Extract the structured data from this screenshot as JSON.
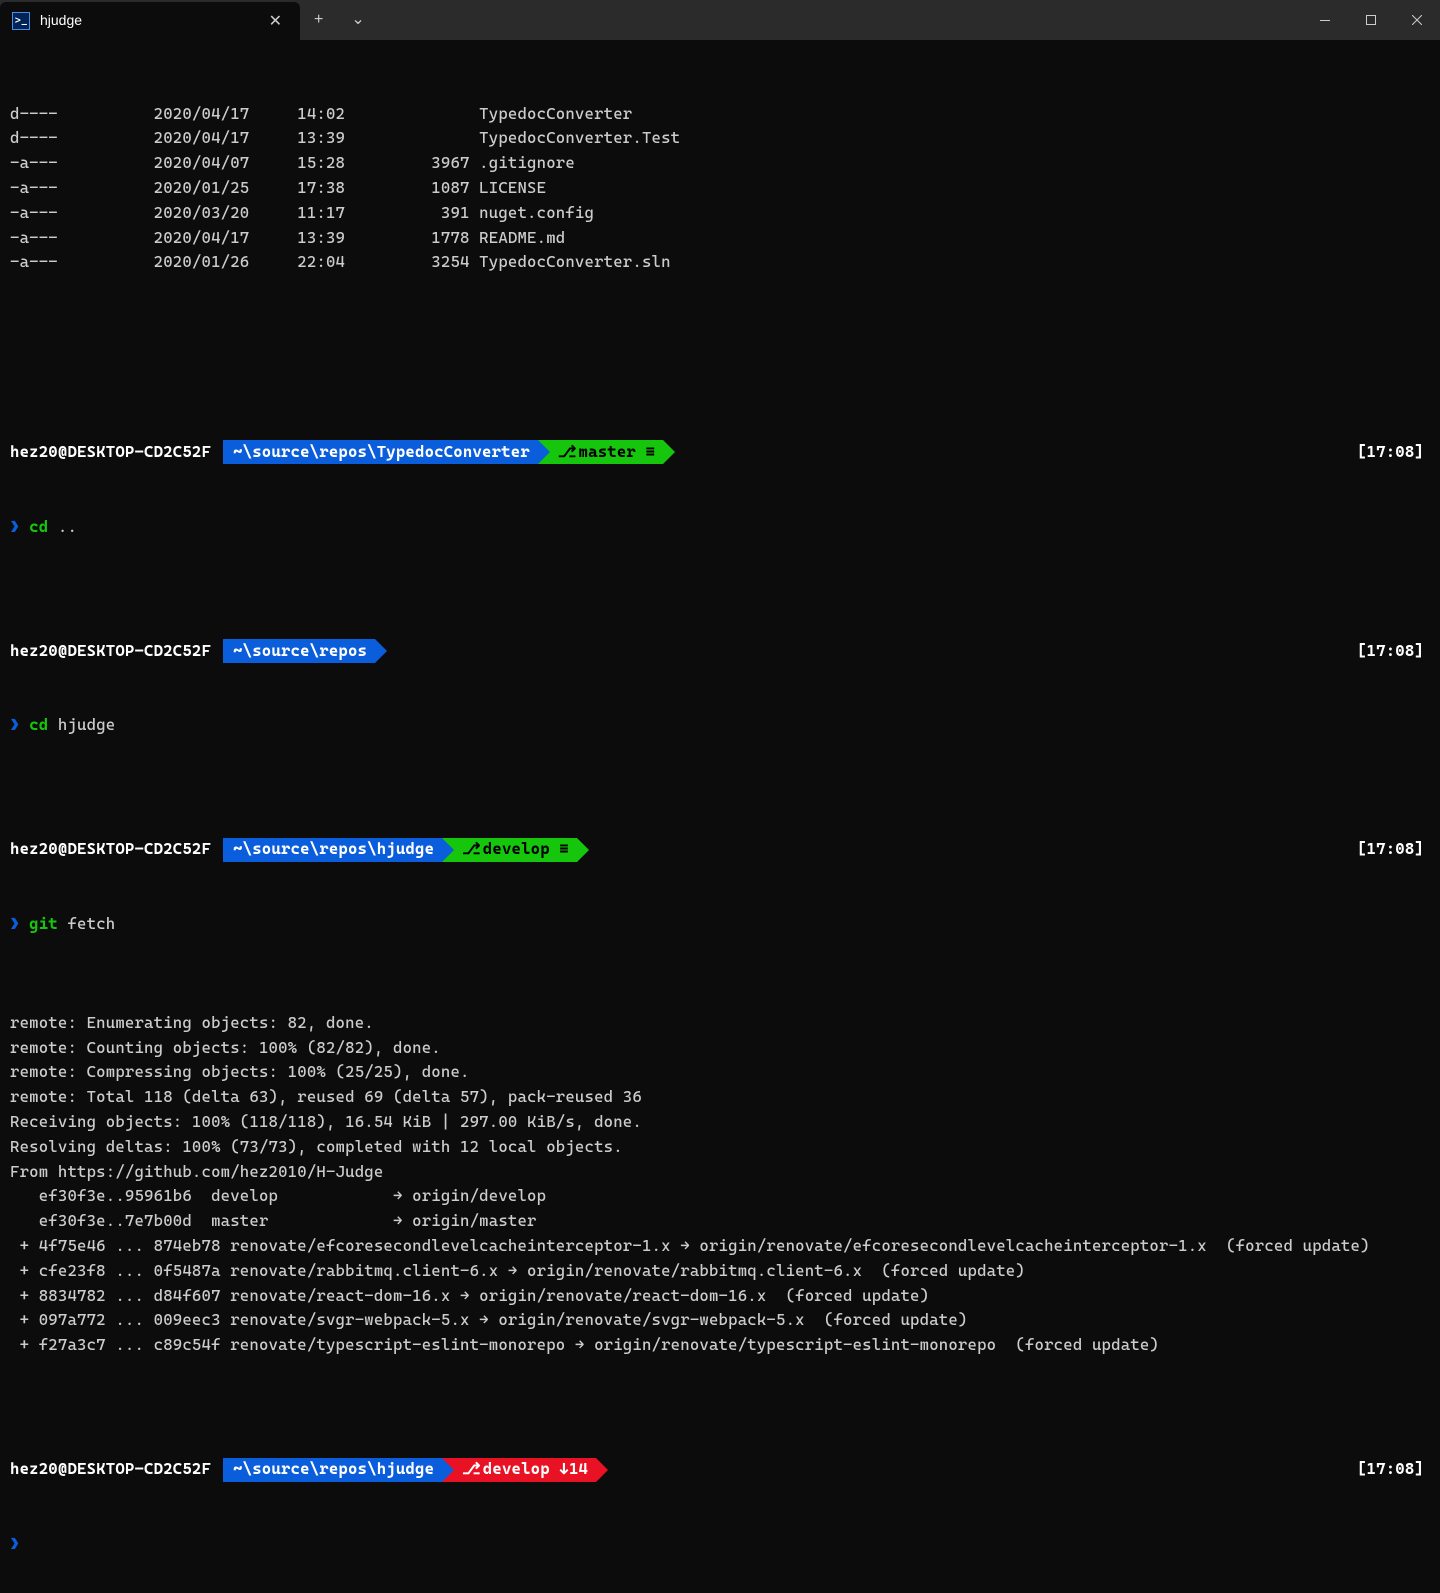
{
  "window": {
    "tab_title": "hjudge",
    "new_tab": "+",
    "dropdown": "⌄",
    "minimize": "—",
    "maximize": "☐",
    "close": "✕"
  },
  "ls": [
    {
      "mode": "d----",
      "date": "2020/04/17",
      "time": "14:02",
      "size": "",
      "name": "TypedocConverter"
    },
    {
      "mode": "d----",
      "date": "2020/04/17",
      "time": "13:39",
      "size": "",
      "name": "TypedocConverter.Test"
    },
    {
      "mode": "-a---",
      "date": "2020/04/07",
      "time": "15:28",
      "size": "3967",
      "name": ".gitignore"
    },
    {
      "mode": "-a---",
      "date": "2020/01/25",
      "time": "17:38",
      "size": "1087",
      "name": "LICENSE"
    },
    {
      "mode": "-a---",
      "date": "2020/03/20",
      "time": "11:17",
      "size": "391",
      "name": "nuget.config"
    },
    {
      "mode": "-a---",
      "date": "2020/04/17",
      "time": "13:39",
      "size": "1778",
      "name": "README.md"
    },
    {
      "mode": "-a---",
      "date": "2020/01/26",
      "time": "22:04",
      "size": "3254",
      "name": "TypedocConverter.sln"
    }
  ],
  "prompts": [
    {
      "user": "hez20@DESKTOP-CD2C52F",
      "path": "~\\source\\repos\\TypedocConverter",
      "branch": "master",
      "branch_extra": " ≡",
      "branch_bg": "green",
      "time": "[17:08]"
    },
    {
      "user": "hez20@DESKTOP-CD2C52F",
      "path": "~\\source\\repos",
      "branch": "",
      "branch_extra": "",
      "branch_bg": "",
      "time": "[17:08]"
    },
    {
      "user": "hez20@DESKTOP-CD2C52F",
      "path": "~\\source\\repos\\hjudge",
      "branch": "develop",
      "branch_extra": " ≡",
      "branch_bg": "green",
      "time": "[17:08]"
    },
    {
      "user": "hez20@DESKTOP-CD2C52F",
      "path": "~\\source\\repos\\hjudge",
      "branch": "develop",
      "branch_extra": " ↓14",
      "branch_bg": "red",
      "time": "[17:08]"
    }
  ],
  "cmds": [
    {
      "prompt": "❯",
      "exec": "cd",
      "args": ".."
    },
    {
      "prompt": "❯",
      "exec": "cd",
      "args": "hjudge"
    },
    {
      "prompt": "❯",
      "exec": "git",
      "args": "fetch"
    },
    {
      "prompt": "❯",
      "exec": "",
      "args": ""
    }
  ],
  "fetch_output": [
    "remote: Enumerating objects: 82, done.",
    "remote: Counting objects: 100% (82/82), done.",
    "remote: Compressing objects: 100% (25/25), done.",
    "remote: Total 118 (delta 63), reused 69 (delta 57), pack-reused 36",
    "Receiving objects: 100% (118/118), 16.54 KiB | 297.00 KiB/s, done.",
    "Resolving deltas: 100% (73/73), completed with 12 local objects.",
    "From https://github.com/hez2010/H-Judge",
    "   ef30f3e..95961b6  develop            → origin/develop",
    "   ef30f3e..7e7b00d  master             → origin/master",
    " + 4f75e46 ... 874eb78 renovate/efcoresecondlevelcacheinterceptor-1.x → origin/renovate/efcoresecondlevelcacheinterceptor-1.x  (forced update)",
    " + cfe23f8 ... 0f5487a renovate/rabbitmq.client-6.x → origin/renovate/rabbitmq.client-6.x  (forced update)",
    " + 8834782 ... d84f607 renovate/react-dom-16.x → origin/renovate/react-dom-16.x  (forced update)",
    " + 097a772 ... 009eec3 renovate/svgr-webpack-5.x → origin/renovate/svgr-webpack-5.x  (forced update)",
    " + f27a3c7 ... c89c54f renovate/typescript-eslint-monorepo → origin/renovate/typescript-eslint-monorepo  (forced update)"
  ],
  "icons": {
    "branch": "⎇",
    "ps": ">_"
  }
}
